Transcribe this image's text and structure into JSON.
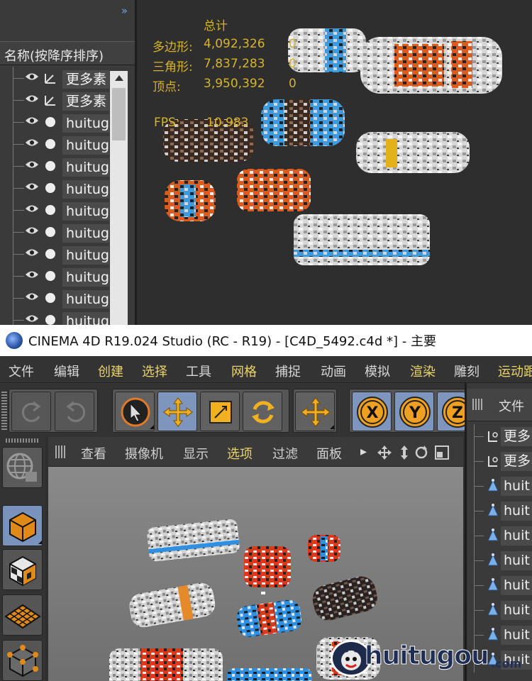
{
  "top_panel": {
    "stats": {
      "heading": "总计",
      "rows": [
        {
          "label": "多边形:",
          "value": "4,092,326",
          "extra": "0"
        },
        {
          "label": "三角形:",
          "value": "7,837,283",
          "extra": "0"
        },
        {
          "label": "顶点:",
          "value": "3,950,392",
          "extra": "0"
        }
      ],
      "fps_label": "FPS:",
      "fps_value": "10.983"
    },
    "object_manager": {
      "collapse_glyph": "»",
      "column_header": "名称(按降序排序)",
      "rows": [
        {
          "icon": "null-object-icon",
          "label": "更多素"
        },
        {
          "icon": "null-object-icon",
          "label": "更多素"
        },
        {
          "icon": "sphere-object-icon",
          "label": "huitug"
        },
        {
          "icon": "sphere-object-icon",
          "label": "huitug"
        },
        {
          "icon": "sphere-object-icon",
          "label": "huitug"
        },
        {
          "icon": "sphere-object-icon",
          "label": "huitug"
        },
        {
          "icon": "sphere-object-icon",
          "label": "huitug"
        },
        {
          "icon": "sphere-object-icon",
          "label": "huitug"
        },
        {
          "icon": "sphere-object-icon",
          "label": "huitug"
        },
        {
          "icon": "sphere-object-icon",
          "label": "huitug"
        },
        {
          "icon": "sphere-object-icon",
          "label": "huitug"
        },
        {
          "icon": "sphere-object-icon",
          "label": "huitug"
        }
      ]
    }
  },
  "window": {
    "title": "CINEMA 4D R19.024 Studio (RC - R19) - [C4D_5492.c4d *] - 主要"
  },
  "menubar": {
    "items": [
      {
        "label": "文件",
        "highlight": false
      },
      {
        "label": "编辑",
        "highlight": false
      },
      {
        "label": "创建",
        "highlight": true
      },
      {
        "label": "选择",
        "highlight": true
      },
      {
        "label": "工具",
        "highlight": false
      },
      {
        "label": "网格",
        "highlight": true
      },
      {
        "label": "捕捉",
        "highlight": false
      },
      {
        "label": "动画",
        "highlight": false
      },
      {
        "label": "模拟",
        "highlight": false
      },
      {
        "label": "渲染",
        "highlight": true
      },
      {
        "label": "雕刻",
        "highlight": false
      },
      {
        "label": "运动跟",
        "highlight": true
      }
    ]
  },
  "toolbar": {
    "buttons": [
      {
        "name": "undo-icon"
      },
      {
        "name": "redo-icon"
      },
      {
        "name": "live-selection-icon"
      },
      {
        "name": "move-icon"
      },
      {
        "name": "scale-icon"
      },
      {
        "name": "rotate-icon"
      },
      {
        "name": "recent-tool-move-icon"
      },
      {
        "name": "x-axis-lock-icon",
        "label": "X"
      },
      {
        "name": "y-axis-lock-icon",
        "label": "Y"
      },
      {
        "name": "z-axis-lock-icon",
        "label": "Z"
      }
    ]
  },
  "viewport": {
    "menu": [
      {
        "label": "查看",
        "highlight": false
      },
      {
        "label": "摄像机",
        "highlight": false
      },
      {
        "label": "显示",
        "highlight": false
      },
      {
        "label": "选项",
        "highlight": true
      },
      {
        "label": "过滤",
        "highlight": false
      },
      {
        "label": "面板",
        "highlight": false
      }
    ],
    "more_glyph": "▸"
  },
  "right_object_manager": {
    "tab_label": "文件",
    "rows": [
      {
        "icon": "null-object-icon",
        "label": "更多"
      },
      {
        "icon": "null-object-icon",
        "label": "更多"
      },
      {
        "icon": "polygon-object-icon",
        "label": "huit"
      },
      {
        "icon": "polygon-object-icon",
        "label": "huit"
      },
      {
        "icon": "polygon-object-icon",
        "label": "huit"
      },
      {
        "icon": "polygon-object-icon",
        "label": "huit"
      },
      {
        "icon": "polygon-object-icon",
        "label": "huit"
      },
      {
        "icon": "polygon-object-icon",
        "label": "huit"
      },
      {
        "icon": "polygon-object-icon",
        "label": "huit"
      },
      {
        "icon": "polygon-object-icon",
        "label": "huit"
      }
    ]
  },
  "watermark": {
    "text": "huitugou",
    "domain": ".com"
  },
  "colors": {
    "stat_text": "#d6b42a",
    "active_blue": "#7e96bd",
    "menu_highlight": "#e9d36a",
    "model_orange": "#e0561a",
    "model_blue": "#2f9be0"
  }
}
